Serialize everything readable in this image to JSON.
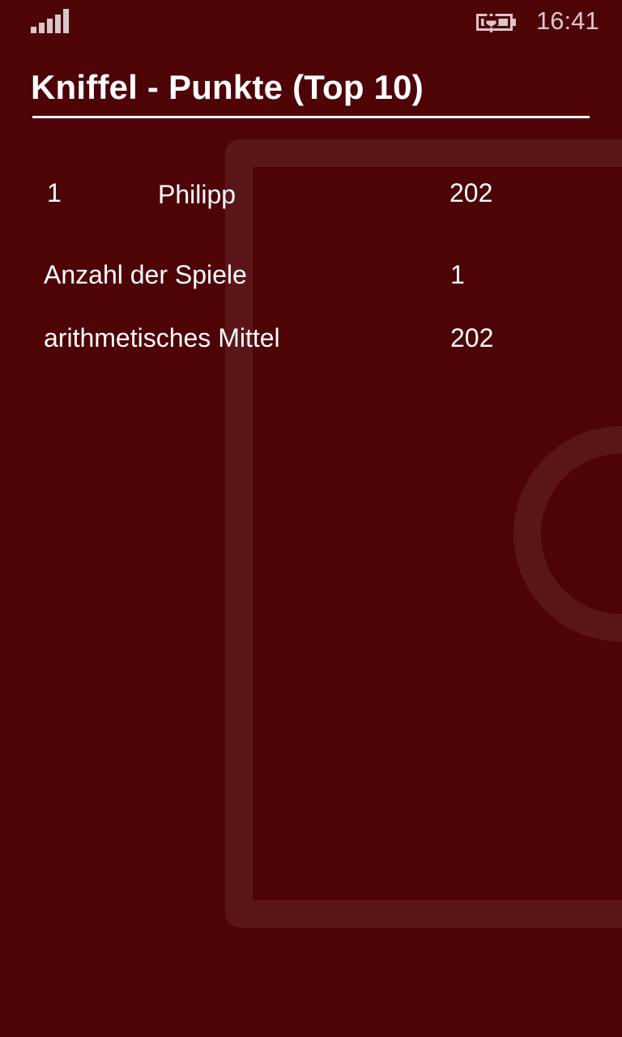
{
  "status_bar": {
    "signal_icon": "signal-strength-icon",
    "battery_icon": "battery-charging-icon",
    "time": "16:41"
  },
  "header": {
    "title": "Kniffel - Punkte (Top 10)"
  },
  "scores": [
    {
      "rank": "1",
      "name": "Philipp",
      "points": "202"
    }
  ],
  "stats": {
    "games_label": "Anzahl der Spiele",
    "games_value": "1",
    "mean_label": "arithmetisches Mittel",
    "mean_value": "202"
  },
  "colors": {
    "background": "#4e0307",
    "text": "#ffffff",
    "status_text": "#d9c7c8"
  }
}
